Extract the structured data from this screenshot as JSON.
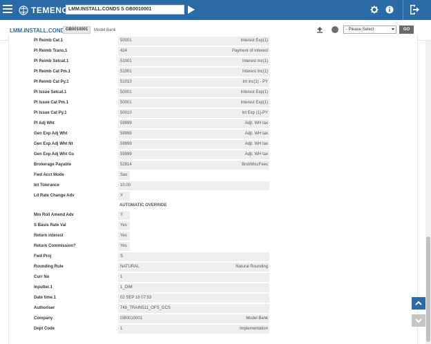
{
  "topbar": {
    "logo_text": "TEMENOS",
    "command": "LMM.INSTALL.CONDS S GB0010001",
    "icons": [
      "menu-icon",
      "run-arrow-icon",
      "settings-gear-icon",
      "info-icon",
      "sign-out-icon"
    ]
  },
  "header": {
    "title": "LMM.INSTALL.CONDS",
    "company_code": "GB0010001",
    "company_name": "Model Bank",
    "select_value": "- Please Select",
    "go_label": "GO"
  },
  "colors": {
    "brand": "#2a6aa6",
    "field_bg": "#eeeeee",
    "label_text": "#333333"
  },
  "fields": [
    {
      "label": "Pl Reimb Cat.1",
      "code": "50001",
      "desc": "Interest Exp(1)"
    },
    {
      "label": "Pl Reimb Trans.1",
      "code": "424",
      "desc": "Payment of Interest"
    },
    {
      "label": "Pl Reimb Setcat.1",
      "code": "51001",
      "desc": "Interest Inc(1)"
    },
    {
      "label": "Pl Reimb Cat Pm.1",
      "code": "51001",
      "desc": "Interest Inc(1)"
    },
    {
      "label": "Pl Reimb Cat Py.1",
      "code": "51010",
      "desc": "Int inc(1) - PY"
    },
    {
      "label": "Pl Issue Setcat.1",
      "code": "50001",
      "desc": "Interest Exp(1)"
    },
    {
      "label": "Pl Issue Cat Pm.1",
      "code": "50001",
      "desc": "Interest Exp(1)"
    },
    {
      "label": "Pl Issue Cat Py.1",
      "code": "50010",
      "desc": "Int Exp (1)-PY"
    },
    {
      "label": "Pl Adj Wht",
      "code": "59999",
      "desc": "Adjt. WH tax"
    },
    {
      "label": "Gen Exp Adj Wht",
      "code": "59999",
      "desc": "Adjt. WH tax"
    },
    {
      "label": "Gen Exp Adj Wht Nt",
      "code": "59999",
      "desc": "Adjt. WH tax"
    },
    {
      "label": "Gen Exp Adj Wht Gs",
      "code": "59999",
      "desc": "Adjt. WH tax"
    },
    {
      "label": "Brokerage Payable",
      "code": "52814",
      "desc": "BrokMiscFees"
    },
    {
      "label": "Fwd Acct Mode",
      "code": "Sas",
      "desc": ""
    },
    {
      "label": "Int Tolerance",
      "code": "10.00",
      "desc": ""
    },
    {
      "label": "Ld Rate Change Adv",
      "code": "Y",
      "desc": ""
    },
    {
      "label": "Mm Roll Amend Adv",
      "code": "Y",
      "desc": ""
    },
    {
      "label": "S Basis Rate Val",
      "code": "Yes",
      "desc": ""
    },
    {
      "label": "Return interest",
      "code": "Yes",
      "desc": ""
    },
    {
      "label": "Return Commission?",
      "code": "Yes",
      "desc": ""
    },
    {
      "label": "Fwd Proj",
      "code": "S",
      "desc": ""
    },
    {
      "label": "Rounding Rule",
      "code": "NATURAL",
      "desc": "Natural Rounding"
    },
    {
      "label": "Curr No",
      "code": "1",
      "desc": ""
    },
    {
      "label": "Inputter.1",
      "code": "1_DIM",
      "desc": ""
    },
    {
      "label": "Date time.1",
      "code": "02 SEP 18 07:53",
      "desc": ""
    },
    {
      "label": "Authoriser",
      "code": "749_TRAIN511_OFS_GCS",
      "desc": ""
    },
    {
      "label": "Company",
      "code": "GB0010001",
      "desc": "Model Bank"
    },
    {
      "label": "Dept Code",
      "code": "1",
      "desc": "Implementation"
    }
  ],
  "override_note": "AUTOMATIC OVERRIDE"
}
